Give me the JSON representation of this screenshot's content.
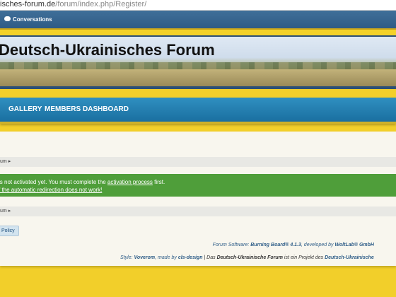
{
  "browser": {
    "url_host": "isches-forum.de",
    "url_path": "/forum/index.php/Register/"
  },
  "userbar": {
    "conversations_label": "Conversations",
    "conversations_icon": "speech-bubbles-icon"
  },
  "header": {
    "title": "Deutsch-Ukrainisches Forum"
  },
  "nav": {
    "tabs": [
      {
        "label": "GALLERY"
      },
      {
        "label": "MEMBERS"
      },
      {
        "label": "DASHBOARD"
      }
    ]
  },
  "breadcrumb_top": {
    "text": "um",
    "arrow": "▸"
  },
  "alert": {
    "line1_prefix": "is not activated yet. You must complete the ",
    "line1_link": "activation process",
    "line1_suffix": " first.",
    "line2_link": "f the automatic redirection does not work!"
  },
  "breadcrumb_bottom": {
    "text": "um",
    "arrow": "▸"
  },
  "policy_button": "Policy",
  "footer": {
    "software_prefix": "Forum Software: ",
    "software_name": "Burning Board® 4.1.3",
    "software_mid": ", developed by ",
    "software_dev": "WoltLab® GmbH",
    "style_prefix": "Style: ",
    "style_name": "Voverom",
    "style_mid": ", made by ",
    "style_author": "cls-design",
    "sep": " | Das ",
    "project_name": "Deutsch-Ukrainische Forum",
    "project_mid": " ist ein Projekt des ",
    "project_owner": "Deutsch-Ukrainische"
  },
  "colors": {
    "page_background": "#f2cf2a",
    "userbar": "#2f5b85",
    "main_nav": "#1a6fa0",
    "success_alert": "#4f9e3a",
    "footer_text": "#2e5d88"
  }
}
